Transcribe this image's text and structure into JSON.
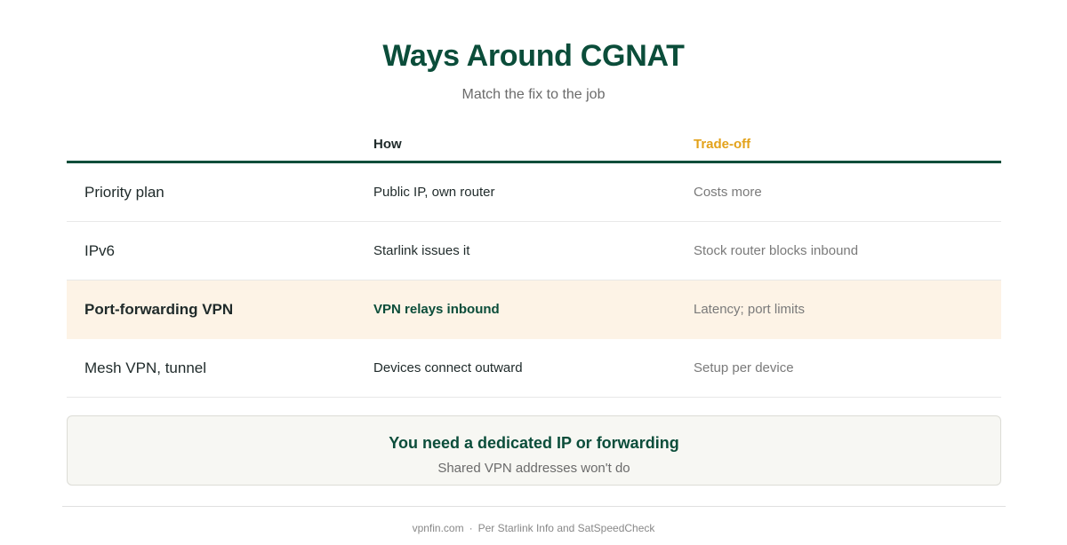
{
  "header": {
    "title": "Ways Around CGNAT",
    "subtitle": "Match the fix to the job"
  },
  "table": {
    "columns": {
      "option": "",
      "how": "How",
      "tradeoff": "Trade-off"
    },
    "rows": [
      {
        "option": "Priority plan",
        "how": "Public IP, own router",
        "tradeoff": "Costs more",
        "highlighted": false
      },
      {
        "option": "IPv6",
        "how": "Starlink issues it",
        "tradeoff": "Stock router blocks inbound",
        "highlighted": false
      },
      {
        "option": "Port-forwarding VPN",
        "how": "VPN relays inbound",
        "tradeoff": "Latency; port limits",
        "highlighted": true
      },
      {
        "option": "Mesh VPN, tunnel",
        "how": "Devices connect outward",
        "tradeoff": "Setup per device",
        "highlighted": false
      }
    ]
  },
  "callout": {
    "title": "You need a dedicated IP or forwarding",
    "subtitle": "Shared VPN addresses won't do"
  },
  "footer": {
    "site": "vpnfin.com",
    "separator": "·",
    "source": "Per Starlink Info and SatSpeedCheck"
  },
  "colors": {
    "primary_green": "#0b4d3a",
    "accent_amber": "#e3a21a",
    "highlight_row_bg": "#fdf3e6"
  }
}
